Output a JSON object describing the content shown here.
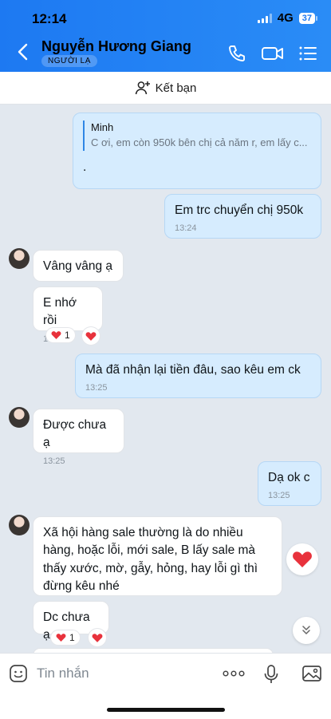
{
  "status_bar": {
    "time": "12:14",
    "network": "4G",
    "battery": "37"
  },
  "header": {
    "contact_name": "Nguyễn Hương Giang",
    "badge": "NGƯỜI LẠ"
  },
  "add_friend": {
    "label": "Kết bạn"
  },
  "messages": [
    {
      "from": "me",
      "quote_name": "Minh",
      "quote_text": "C ơi, em còn 950k bên chị cả năm r, em lấy c...",
      "text": "."
    },
    {
      "from": "me",
      "text": "Em trc chuyển chị 950k",
      "time": "13:24"
    },
    {
      "from": "other",
      "text": "Vâng vâng ạ"
    },
    {
      "from": "other",
      "text": "E nhớ rồi",
      "time": "13:25",
      "reaction_count": "1"
    },
    {
      "from": "me",
      "text": "Mà đã nhận lại tiền đâu, sao kêu em ck",
      "time": "13:25"
    },
    {
      "from": "other",
      "text": "Được chưa ạ",
      "time": "13:25"
    },
    {
      "from": "me",
      "text": "Dạ ok c",
      "time": "13:25"
    },
    {
      "from": "other",
      "text": "Xã hội hàng sale  thường là do nhiều hàng, hoặc lỗi, mới sale,  B lấy sale  mà thấy xước,  mờ,  gẫy, hỏng,  hay lỗi gì thì đừng kêu nhé"
    },
    {
      "from": "other",
      "text": "Dc chưa ạ",
      "reaction_count": "1"
    }
  ],
  "input": {
    "placeholder": "Tin nhắn"
  },
  "colors": {
    "header_blue": "#1d79f2",
    "my_bubble": "#d6ecfe",
    "heart_red": "#e8323c"
  }
}
